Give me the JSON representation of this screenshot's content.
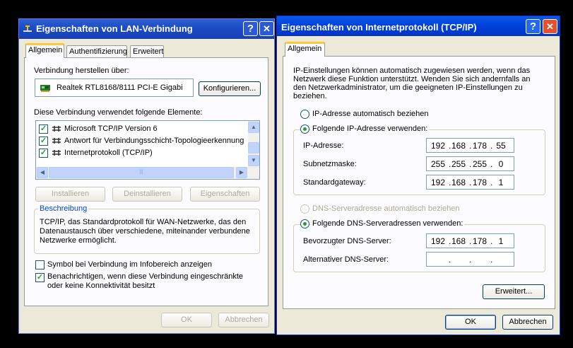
{
  "left": {
    "title": "Eigenschaften von LAN-Verbindung",
    "help_btn": "?",
    "close_btn": "✕",
    "tabs": [
      "Allgemein",
      "Authentifizierung",
      "Erweitert"
    ],
    "connect_using_label": "Verbindung herstellen über:",
    "adapter_name": "Realtek RTL8168/8111 PCI-E Gigabi",
    "configure_btn": "Konfigurieren...",
    "components_label": "Diese Verbindung verwendet folgende Elemente:",
    "components": [
      {
        "label": "Microsoft TCP/IP Version 6",
        "checked": true
      },
      {
        "label": "Antwort für Verbindungsschicht-Topologieerkennung",
        "checked": true
      },
      {
        "label": "Internetprotokoll (TCP/IP)",
        "checked": true
      }
    ],
    "hscroll_grip": "|||",
    "install_btn": "Installieren",
    "uninstall_btn": "Deinstallieren",
    "properties_btn": "Eigenschaften",
    "description_title": "Beschreibung",
    "description_text": "TCP/IP, das Standardprotokoll für WAN-Netzwerke, das den Datenaustausch über verschiedene, miteinander verbundene Netzwerke ermöglicht.",
    "show_icon_label": "Symbol bei Verbindung im Infobereich anzeigen",
    "show_icon_checked": false,
    "notify_label": "Benachrichtigen, wenn diese Verbindung eingeschränkte oder keine Konnektivität besitzt",
    "notify_checked": true,
    "ok_btn": "OK",
    "cancel_btn": "Abbrechen"
  },
  "right": {
    "title": "Eigenschaften von Internetprotokoll (TCP/IP)",
    "help_btn": "?",
    "close_btn": "✕",
    "tab": "Allgemein",
    "intro": "IP-Einstellungen können automatisch zugewiesen werden, wenn das Netzwerk diese Funktion unterstützt. Wenden Sie sich andernfalls an den Netzwerkadministrator, um die geeigneten IP-Einstellungen zu beziehen.",
    "auto_ip_label": "IP-Adresse automatisch beziehen",
    "use_ip_label": "Folgende IP-Adresse verwenden:",
    "ip_label": "IP-Adresse:",
    "ip": [
      "192",
      "168",
      "178",
      "55"
    ],
    "mask_label": "Subnetzmaske:",
    "mask": [
      "255",
      "255",
      "255",
      "0"
    ],
    "gateway_label": "Standardgateway:",
    "gateway": [
      "192",
      "168",
      "178",
      "1"
    ],
    "auto_dns_label": "DNS-Serveradresse automatisch beziehen",
    "use_dns_label": "Folgende DNS-Serveradressen verwenden:",
    "pref_dns_label": "Bevorzugter DNS-Server:",
    "pref_dns": [
      "192",
      "168",
      "178",
      "1"
    ],
    "alt_dns_label": "Alternativer DNS-Server:",
    "alt_dns": [
      "",
      "",
      "",
      ""
    ],
    "advanced_btn": "Erweitert...",
    "ok_btn": "OK",
    "cancel_btn": "Abbrechen"
  },
  "colors": {
    "title_active": "#0a246a",
    "title_inactive": "#7a96df",
    "close_red": "#e1532f",
    "group_title": "#0046d5"
  }
}
